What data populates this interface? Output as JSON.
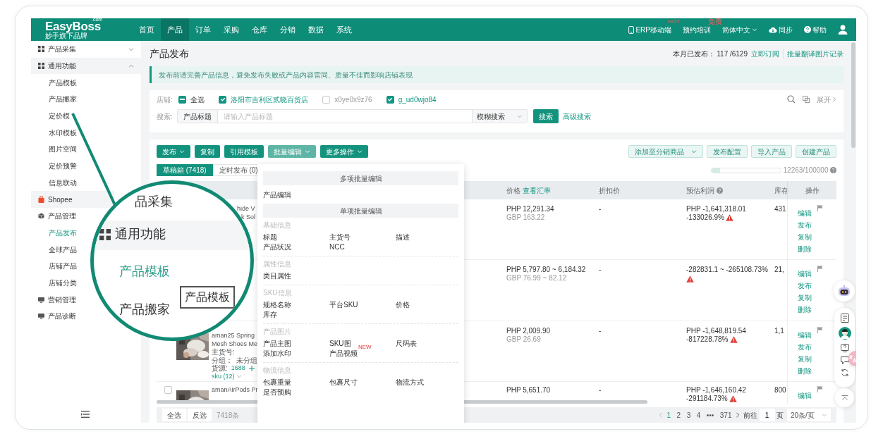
{
  "nav": {
    "logo": "EasyBoss",
    "logo_sup": ".com",
    "logo_sub": "妙手旗下品牌",
    "menu": [
      {
        "label": "首页",
        "selected": false
      },
      {
        "label": "产品",
        "selected": true
      },
      {
        "label": "订单",
        "selected": false
      },
      {
        "label": "采购",
        "selected": false
      },
      {
        "label": "仓库",
        "selected": false
      },
      {
        "label": "分销",
        "selected": false
      },
      {
        "label": "数据",
        "selected": false
      },
      {
        "label": "系统",
        "selected": false
      }
    ],
    "right": [
      {
        "kind": "mobile",
        "label": "ERP移动端",
        "badge": "HOT"
      },
      {
        "kind": "plain",
        "label": "预约培训",
        "badge": "免费"
      },
      {
        "kind": "dropdown",
        "label": "简体中文"
      },
      {
        "kind": "sync",
        "label": "同步"
      },
      {
        "kind": "help",
        "label": "帮助"
      }
    ]
  },
  "sidebar": {
    "items": [
      {
        "kind": "group",
        "label": "产品采集",
        "expanded": false
      },
      {
        "kind": "group",
        "label": "通用功能",
        "expanded": true,
        "children": [
          {
            "label": "产品模板",
            "selected": false
          },
          {
            "label": "产品搬家",
            "selected": false
          },
          {
            "label": "定价模",
            "selected": false
          },
          {
            "label": "水印模板",
            "selected": false
          },
          {
            "label": "图片空间",
            "selected": false
          },
          {
            "label": "定价预警",
            "selected": false
          },
          {
            "label": "信息联动",
            "selected": false
          }
        ]
      },
      {
        "kind": "shop",
        "label": "Shopee"
      },
      {
        "kind": "catalog",
        "label": "产品管理",
        "children": [
          {
            "label": "产品发布",
            "selected": true
          },
          {
            "label": "全球产品",
            "selected": false
          },
          {
            "label": "店铺产品",
            "selected": false
          },
          {
            "label": "店铺分类",
            "selected": false
          }
        ]
      },
      {
        "kind": "panel",
        "label": "营销管理"
      },
      {
        "kind": "panel",
        "label": "产品诊断"
      }
    ]
  },
  "page": {
    "title": "产品发布",
    "monthly_label": "本月已发布：",
    "monthly_value": "117 /6129",
    "subscribe_link": "立即订阅",
    "translate_link": "批量翻译图片记录"
  },
  "notice": "发布前请完善产品信息，避免发布失败或产品内容雷同、质量不佳而影响店铺表现",
  "filters": {
    "shop_label": "店铺:",
    "shops": [
      {
        "label": "全选",
        "checked": true,
        "indeterminate": true
      },
      {
        "label": "洛阳市吉利区贰晓百货店",
        "checked": true
      },
      {
        "label": "x0ye0x9z76",
        "checked": false
      },
      {
        "label": "g_ud0wjo84",
        "checked": true
      }
    ],
    "expand": "展开",
    "search_label": "搜索:",
    "field": "产品标题",
    "placeholder": "请输入产品标题",
    "mode": "模糊搜索",
    "search_button": "搜索",
    "advanced": "高级搜索"
  },
  "actions": {
    "left": [
      {
        "label": "发布",
        "dropdown": true,
        "selected": false
      },
      {
        "label": "复制",
        "dropdown": false,
        "selected": false
      },
      {
        "label": "引用模板",
        "dropdown": false,
        "selected": false
      },
      {
        "label": "批量编辑",
        "dropdown": true,
        "selected": true
      },
      {
        "label": "更多操作",
        "dropdown": true,
        "selected": false
      }
    ],
    "right": [
      {
        "label": "添加至分销商品",
        "dropdown": true
      },
      {
        "label": "发布配置",
        "dropdown": false
      },
      {
        "label": "导入产品",
        "dropdown": false
      },
      {
        "label": "创建产品",
        "dropdown": false
      }
    ]
  },
  "tabs": [
    {
      "label": "草稿箱 (7418)",
      "selected": true
    },
    {
      "label": "定时发布 (0)",
      "selected": false
    }
  ],
  "quota": {
    "level": 0.12263,
    "text": "12263/100000"
  },
  "table": {
    "columns": [
      {
        "label": "价格",
        "link": "查看汇率"
      },
      {
        "label": "折扣价"
      },
      {
        "label": "预估利润",
        "help": true
      },
      {
        "label": "库存"
      },
      {
        "label": "操作"
      }
    ],
    "rows": [
      {
        "product": {
          "fragments": [
            "hide V",
            "k Sol"
          ]
        },
        "price": "PHP 12,291.34",
        "price_alt": "GBP 163.22",
        "discount": "-",
        "profit": [
          "PHP -1,641,318.01",
          "-133026.9%"
        ],
        "warning": true,
        "stock": "431",
        "actions": [
          "编辑",
          "发布",
          "复制",
          "删除"
        ]
      },
      {
        "price": "PHP 5,797.80 ~ 6,184.32",
        "price_alt": "GBP 76.99 ~ 82.12",
        "discount": "-",
        "profit": [
          "-282831.1 ~ -265108.73%"
        ],
        "warning": true,
        "stock": "21,",
        "actions": [
          "编辑",
          "发布",
          "复制",
          "删除"
        ]
      },
      {
        "product": {
          "thumbnail": {
            "kind": "picture"
          },
          "title": [
            "aman25 Spring",
            "Mesh Shoes Me"
          ],
          "code_label": "主货号:",
          "group_label": "分组：",
          "group": "未分组",
          "source_label": "货源:",
          "source": "1688",
          "sku": "sku (12)"
        },
        "price": "PHP 2,009.90",
        "price_alt": "GBP 26.69",
        "discount": "-",
        "profit": [
          "PHP -1,648,819.54",
          "-817228.78%"
        ],
        "warning": true,
        "stock": "1,1",
        "actions": [
          "编辑",
          "发布",
          "复制",
          "删除"
        ]
      },
      {
        "checked": false,
        "product": {
          "thumbnail": {
            "kind": "picture"
          },
          "title": [
            "amanAirPods Pr"
          ]
        },
        "price": "PHP 5,651.70",
        "discount": "-",
        "profit": [
          "PHP -1,646,160.42",
          "-291184.73%"
        ],
        "warning": true,
        "stock": "800",
        "actions": [
          "编辑"
        ]
      }
    ]
  },
  "footer": {
    "select_all": "全选",
    "invert": "反选",
    "count": "7418条",
    "pages": [
      {
        "label": "1",
        "selected": true
      },
      {
        "label": "2",
        "selected": false
      },
      {
        "label": "3",
        "selected": false
      },
      {
        "label": "4",
        "selected": false
      }
    ],
    "ellipsis": "•••",
    "last": "371",
    "goto_label": "前往",
    "goto_value": "1",
    "page_unit": "页",
    "page_size": "20条/页"
  },
  "batch_menu": {
    "multi_header": "多项批量编辑",
    "multi_items": [
      "产品编辑"
    ],
    "single_header": "单项批量编辑",
    "groups": [
      {
        "title": "基础信息",
        "items": [
          {
            "label": "标题"
          },
          {
            "label": "主货号"
          },
          {
            "label": "描述"
          },
          {
            "label": "产品状况"
          },
          {
            "label": "NCC"
          }
        ]
      },
      {
        "title": "属性信息",
        "items": [
          {
            "label": "类目属性"
          }
        ]
      },
      {
        "title": "SKU信息",
        "items": [
          {
            "label": "规格名称"
          },
          {
            "label": "平台SKU"
          },
          {
            "label": "价格"
          },
          {
            "label": "库存"
          }
        ]
      },
      {
        "title": "产品图片",
        "items": [
          {
            "label": "产品主图"
          },
          {
            "label": "SKU图"
          },
          {
            "label": "尺码表"
          },
          {
            "label": "添加水印"
          },
          {
            "label": "产品视频",
            "badge": "NEW"
          }
        ]
      },
      {
        "title": "物流信息",
        "items": [
          {
            "label": "包裹重量"
          },
          {
            "label": "包裹尺寸"
          },
          {
            "label": "物流方式"
          },
          {
            "label": "是否预购"
          }
        ]
      }
    ]
  },
  "magnifier": {
    "items": [
      {
        "kind": "plain",
        "label": "品采集"
      },
      {
        "kind": "group",
        "label": "通用功能"
      },
      {
        "kind": "active",
        "label": "产品模板"
      },
      {
        "kind": "plain",
        "label": "产品搬家"
      }
    ],
    "tooltip": "产品模板"
  }
}
